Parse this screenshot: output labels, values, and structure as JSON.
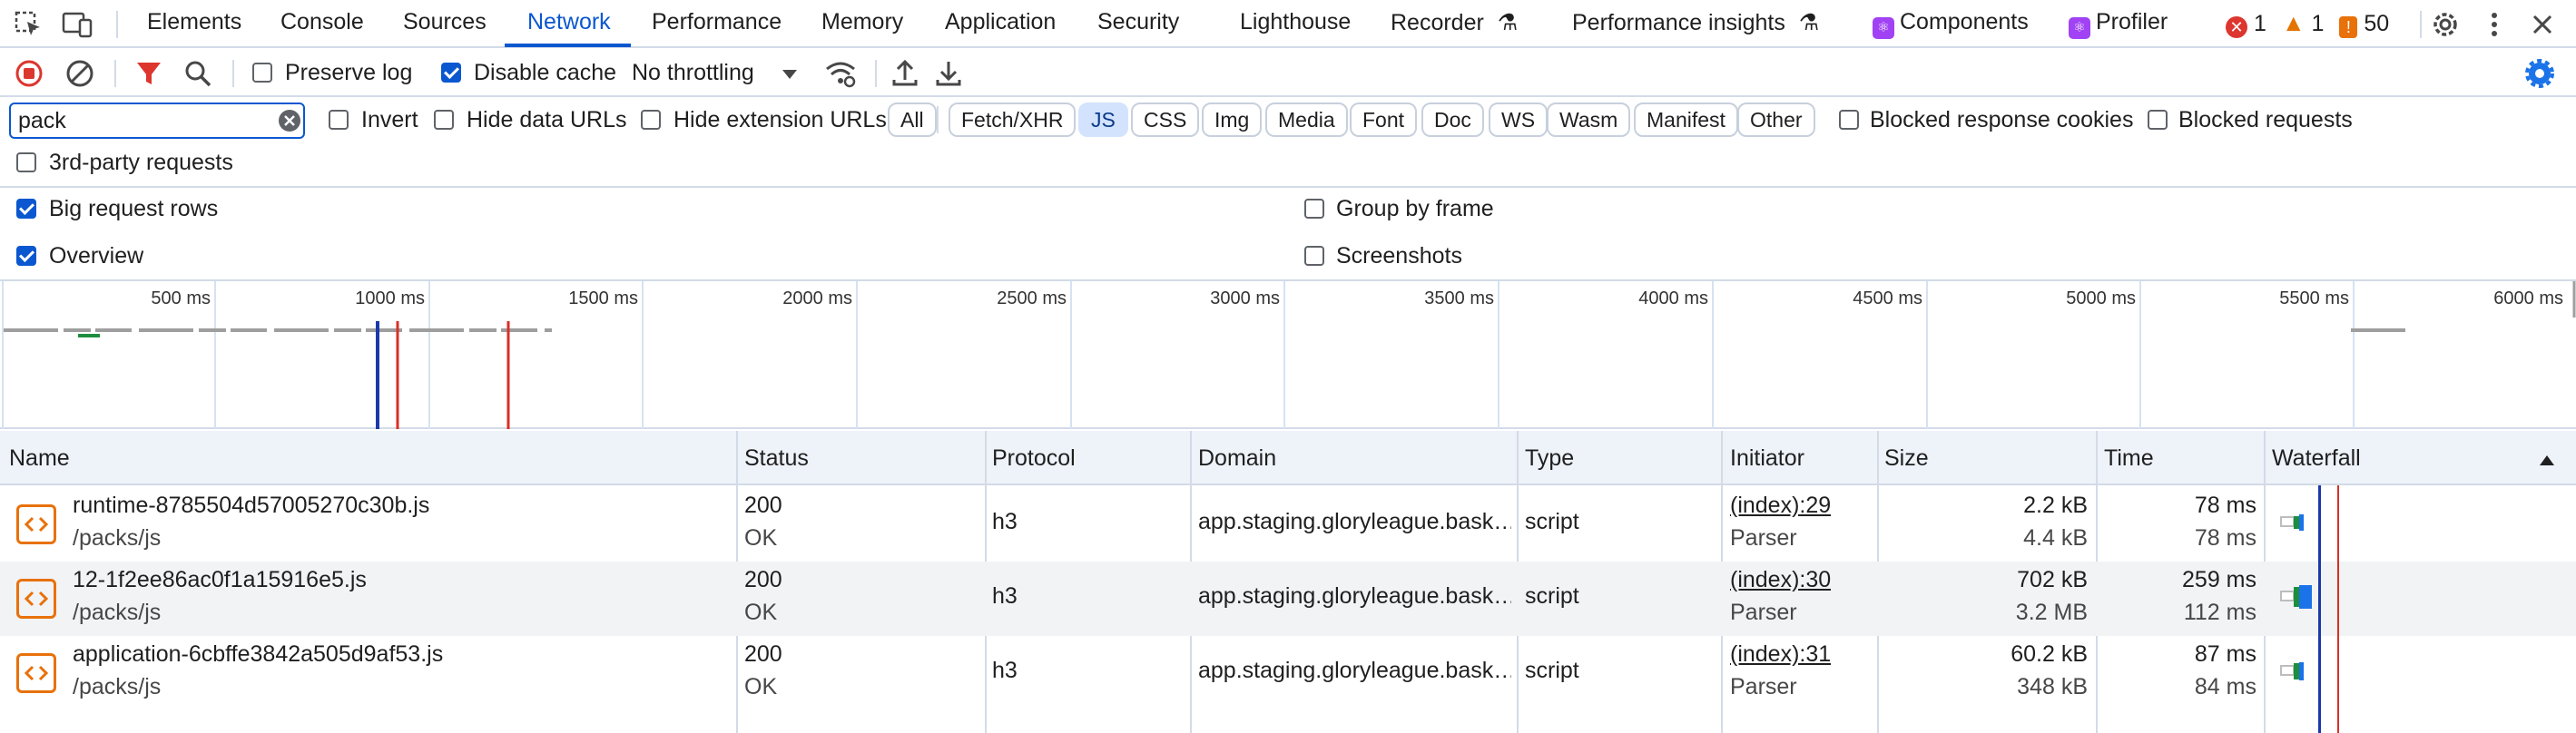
{
  "tabs": {
    "elements": "Elements",
    "console": "Console",
    "sources": "Sources",
    "network": "Network",
    "performance": "Performance",
    "memory": "Memory",
    "application": "Application",
    "security": "Security",
    "lighthouse": "Lighthouse",
    "recorder": "Recorder",
    "performance_insights": "Performance insights",
    "components": "Components",
    "profiler": "Profiler"
  },
  "issues": {
    "errors": "1",
    "warnings": "1",
    "info": "50"
  },
  "toolbar": {
    "preserve_log": "Preserve log",
    "preserve_log_checked": false,
    "disable_cache": "Disable cache",
    "disable_cache_checked": true,
    "throttling": "No throttling"
  },
  "filter": {
    "search_value": "pack",
    "invert": "Invert",
    "hide_data_urls": "Hide data URLs",
    "hide_extension_urls": "Hide extension URLs",
    "types": [
      "All",
      "Fetch/XHR",
      "JS",
      "CSS",
      "Img",
      "Media",
      "Font",
      "Doc",
      "WS",
      "Wasm",
      "Manifest",
      "Other"
    ],
    "active_type": "JS",
    "blocked_response_cookies": "Blocked response cookies",
    "blocked_requests": "Blocked requests",
    "third_party": "3rd-party requests"
  },
  "settings": {
    "big_request_rows": "Big request rows",
    "group_by_frame": "Group by frame",
    "overview": "Overview",
    "screenshots": "Screenshots"
  },
  "overview": {
    "ticks": [
      "500 ms",
      "1000 ms",
      "1500 ms",
      "2000 ms",
      "2500 ms",
      "3000 ms",
      "3500 ms",
      "4000 ms",
      "4500 ms",
      "5000 ms",
      "5500 ms",
      "6000 ms"
    ]
  },
  "columns": {
    "name": "Name",
    "status": "Status",
    "protocol": "Protocol",
    "domain": "Domain",
    "type": "Type",
    "initiator": "Initiator",
    "size": "Size",
    "time": "Time",
    "waterfall": "Waterfall"
  },
  "rows": [
    {
      "name": "runtime-8785504d57005270c30b.js",
      "path": "/packs/js",
      "status": "200",
      "status_text": "OK",
      "protocol": "h3",
      "domain": "app.staging.gloryleague.bask…",
      "type": "script",
      "initiator": "(index):29",
      "initiator_type": "Parser",
      "size": "2.2 kB",
      "resource_size": "4.4 kB",
      "time": "78 ms",
      "latency": "78 ms"
    },
    {
      "name": "12-1f2ee86ac0f1a15916e5.js",
      "path": "/packs/js",
      "status": "200",
      "status_text": "OK",
      "protocol": "h3",
      "domain": "app.staging.gloryleague.bask…",
      "type": "script",
      "initiator": "(index):30",
      "initiator_type": "Parser",
      "size": "702 kB",
      "resource_size": "3.2 MB",
      "time": "259 ms",
      "latency": "112 ms"
    },
    {
      "name": "application-6cbffe3842a505d9af53.js",
      "path": "/packs/js",
      "status": "200",
      "status_text": "OK",
      "protocol": "h3",
      "domain": "app.staging.gloryleague.bask…",
      "type": "script",
      "initiator": "(index):31",
      "initiator_type": "Parser",
      "size": "60.2 kB",
      "resource_size": "348 kB",
      "time": "87 ms",
      "latency": "84 ms"
    }
  ]
}
